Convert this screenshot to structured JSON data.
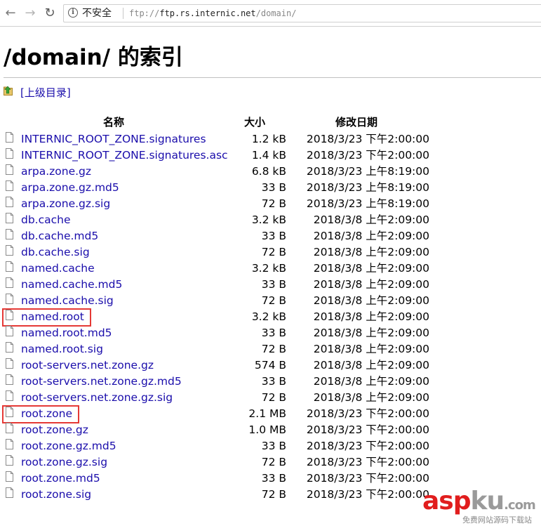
{
  "browser": {
    "security_label": "不安全",
    "url_scheme": "ftp://",
    "url_host": "ftp.rs.internic.net",
    "url_path": "/domain/",
    "icons": {
      "back": "back-arrow-icon",
      "forward": "forward-arrow-icon",
      "reload": "reload-icon",
      "info": "info-icon"
    }
  },
  "page": {
    "title": "/domain/ 的索引",
    "parent_link": "[上级目录]"
  },
  "table": {
    "headers": {
      "name": "名称",
      "size": "大小",
      "date": "修改日期"
    },
    "rows": [
      {
        "name": "INTERNIC_ROOT_ZONE.signatures",
        "size": "1.2 kB",
        "date": "2018/3/23 下午2:00:00"
      },
      {
        "name": "INTERNIC_ROOT_ZONE.signatures.asc",
        "size": "1.4 kB",
        "date": "2018/3/23 下午2:00:00"
      },
      {
        "name": "arpa.zone.gz",
        "size": "6.8 kB",
        "date": "2018/3/23 上午8:19:00"
      },
      {
        "name": "arpa.zone.gz.md5",
        "size": "33 B",
        "date": "2018/3/23 上午8:19:00"
      },
      {
        "name": "arpa.zone.gz.sig",
        "size": "72 B",
        "date": "2018/3/23 上午8:19:00"
      },
      {
        "name": "db.cache",
        "size": "3.2 kB",
        "date": "2018/3/8 上午2:09:00"
      },
      {
        "name": "db.cache.md5",
        "size": "33 B",
        "date": "2018/3/8 上午2:09:00"
      },
      {
        "name": "db.cache.sig",
        "size": "72 B",
        "date": "2018/3/8 上午2:09:00"
      },
      {
        "name": "named.cache",
        "size": "3.2 kB",
        "date": "2018/3/8 上午2:09:00"
      },
      {
        "name": "named.cache.md5",
        "size": "33 B",
        "date": "2018/3/8 上午2:09:00"
      },
      {
        "name": "named.cache.sig",
        "size": "72 B",
        "date": "2018/3/8 上午2:09:00"
      },
      {
        "name": "named.root",
        "size": "3.2 kB",
        "date": "2018/3/8 上午2:09:00",
        "highlighted": true
      },
      {
        "name": "named.root.md5",
        "size": "33 B",
        "date": "2018/3/8 上午2:09:00"
      },
      {
        "name": "named.root.sig",
        "size": "72 B",
        "date": "2018/3/8 上午2:09:00"
      },
      {
        "name": "root-servers.net.zone.gz",
        "size": "574 B",
        "date": "2018/3/8 上午2:09:00"
      },
      {
        "name": "root-servers.net.zone.gz.md5",
        "size": "33 B",
        "date": "2018/3/8 上午2:09:00"
      },
      {
        "name": "root-servers.net.zone.gz.sig",
        "size": "72 B",
        "date": "2018/3/8 上午2:09:00"
      },
      {
        "name": "root.zone",
        "size": "2.1 MB",
        "date": "2018/3/23 下午2:00:00",
        "highlighted": true
      },
      {
        "name": "root.zone.gz",
        "size": "1.0 MB",
        "date": "2018/3/23 下午2:00:00"
      },
      {
        "name": "root.zone.gz.md5",
        "size": "33 B",
        "date": "2018/3/23 下午2:00:00"
      },
      {
        "name": "root.zone.gz.sig",
        "size": "72 B",
        "date": "2018/3/23 下午2:00:00"
      },
      {
        "name": "root.zone.md5",
        "size": "33 B",
        "date": "2018/3/23 下午2:00:00"
      },
      {
        "name": "root.zone.sig",
        "size": "72 B",
        "date": "2018/3/23 下午2:00:00"
      }
    ]
  },
  "watermark": {
    "asp": "asp",
    "ku": "ku",
    "dom": ".com",
    "sub": "免费网站源码下载站"
  },
  "colors": {
    "link": "#1a0dab",
    "highlight": "#e53935",
    "watermark_red": "#e11d1d"
  }
}
